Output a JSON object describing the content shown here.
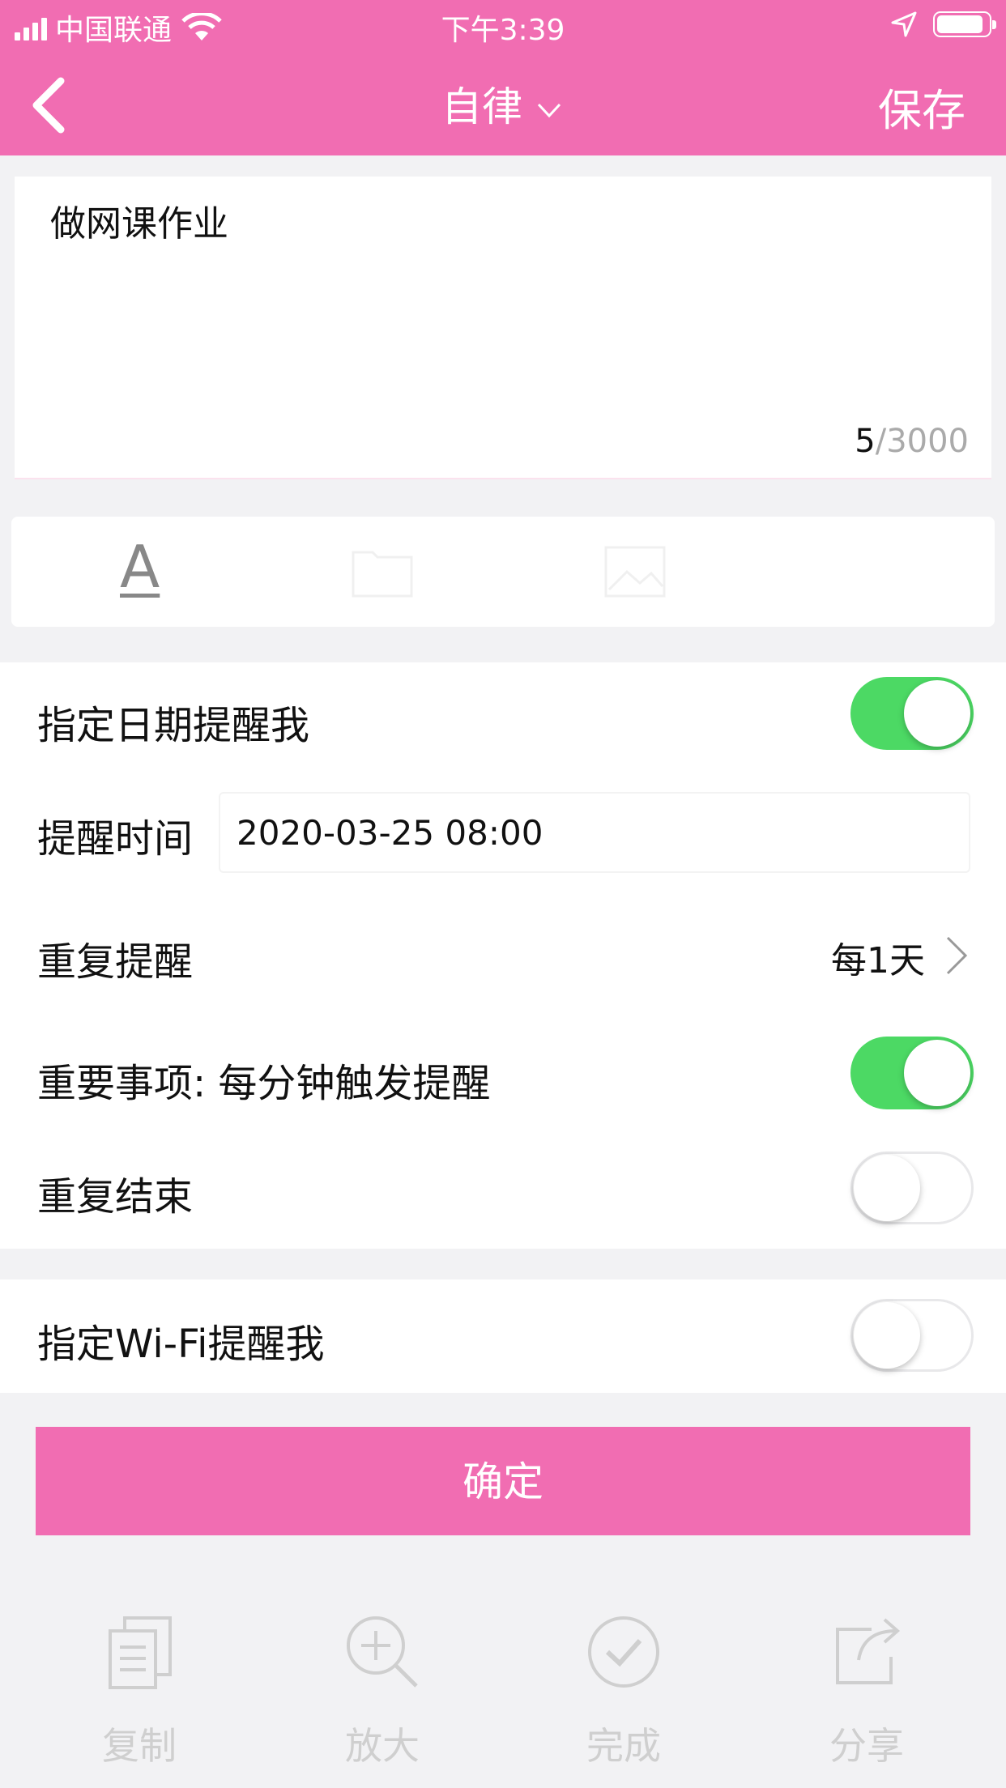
{
  "status": {
    "carrier": "中国联通",
    "time": "下午3:39",
    "battery_level": 0.9
  },
  "nav": {
    "title": "自律",
    "save_label": "保存"
  },
  "note": {
    "text": "做网课作业",
    "count": "5",
    "max": "/3000"
  },
  "tools": {
    "text_format_glyph": "A"
  },
  "settings": {
    "date_reminder": {
      "label": "指定日期提醒我",
      "enabled": true
    },
    "reminder_time": {
      "label": "提醒时间",
      "value": "2020-03-25 08:00"
    },
    "repeat": {
      "label": "重复提醒",
      "value": "每1天"
    },
    "important": {
      "label": "重要事项: 每分钟触发提醒",
      "enabled": true
    },
    "repeat_end": {
      "label": "重复结束",
      "enabled": false
    },
    "wifi_reminder": {
      "label": "指定Wi-Fi提醒我",
      "enabled": false
    }
  },
  "confirm_label": "确定",
  "bottom_toolbar": [
    {
      "label": "复制",
      "icon": "copy-icon"
    },
    {
      "label": "放大",
      "icon": "zoom-in-icon"
    },
    {
      "label": "完成",
      "icon": "check-circle-icon"
    },
    {
      "label": "分享",
      "icon": "share-icon"
    }
  ],
  "colors": {
    "accent": "#f16db2",
    "toggle_on": "#4cd964",
    "disabled_icon": "#cfcfcf"
  }
}
